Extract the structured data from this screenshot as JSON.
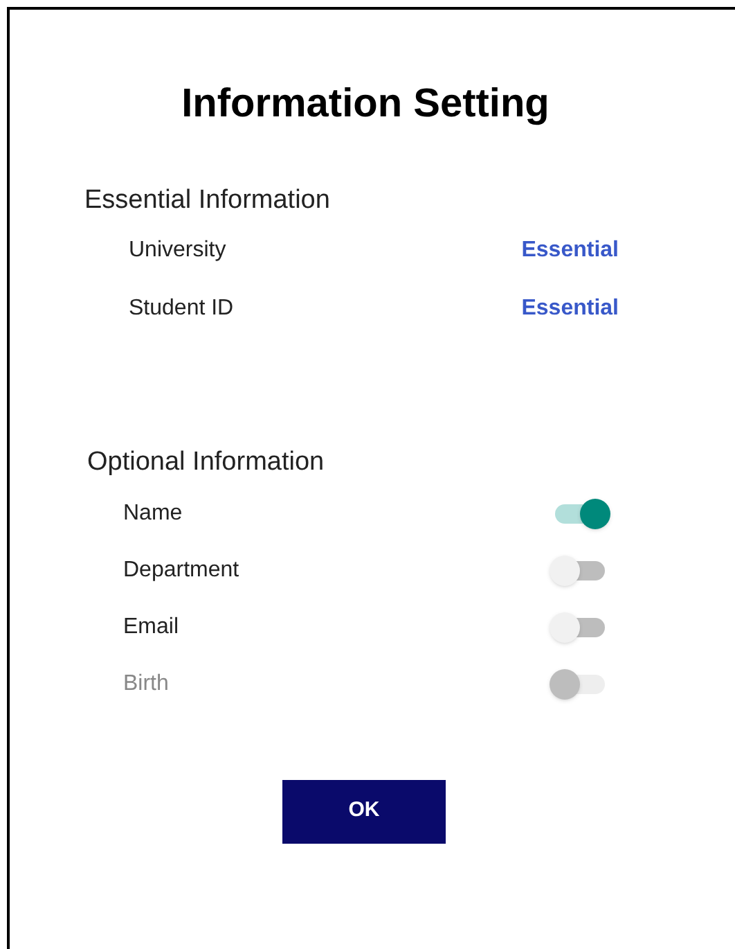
{
  "title": "Information Setting",
  "essential": {
    "heading": "Essential Information",
    "items": [
      {
        "label": "University",
        "status": "Essential"
      },
      {
        "label": "Student ID",
        "status": "Essential"
      }
    ]
  },
  "optional": {
    "heading": "Optional Information",
    "items": [
      {
        "label": "Name",
        "on": true,
        "disabled": false
      },
      {
        "label": "Department",
        "on": false,
        "disabled": false
      },
      {
        "label": "Email",
        "on": false,
        "disabled": false
      },
      {
        "label": "Birth",
        "on": false,
        "disabled": true
      }
    ]
  },
  "button": "OK"
}
